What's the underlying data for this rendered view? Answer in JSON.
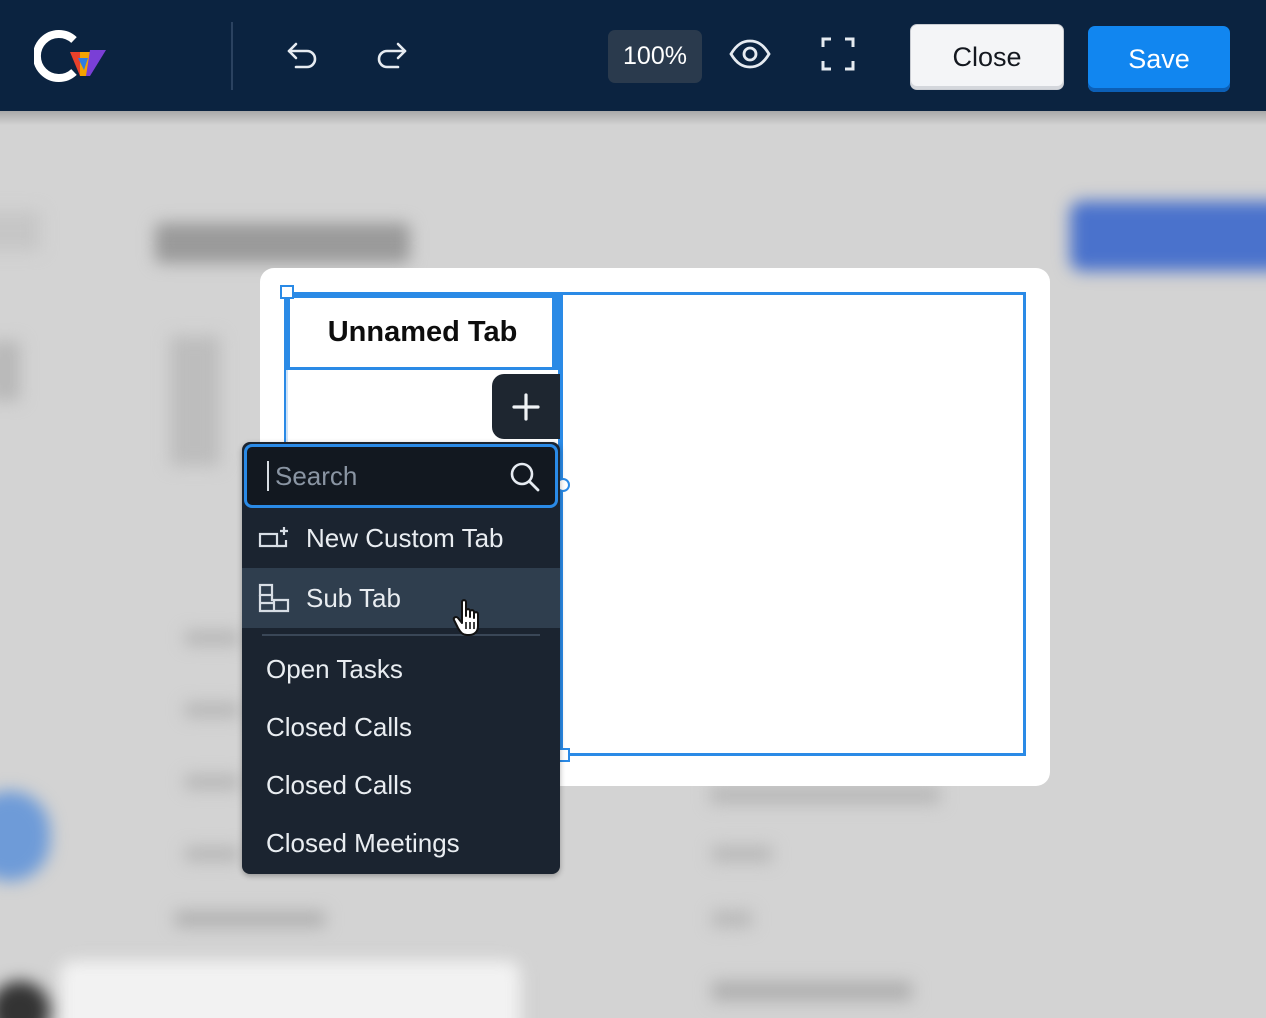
{
  "toolbar": {
    "zoom": "100%",
    "close_label": "Close",
    "save_label": "Save",
    "icons": [
      "logo-icon",
      "undo-icon",
      "redo-icon",
      "preview-eye-icon",
      "fullscreen-icon"
    ]
  },
  "canvas": {
    "tab_title": "Unnamed Tab"
  },
  "dropdown": {
    "search_placeholder": "Search",
    "actions": [
      {
        "label": "New Custom Tab",
        "icon": "new-custom-tab-icon"
      },
      {
        "label": "Sub Tab",
        "icon": "sub-tab-icon"
      }
    ],
    "items": [
      "Open Tasks",
      "Closed Calls",
      "Closed Calls",
      "Closed Meetings"
    ]
  },
  "colors": {
    "topbar": "#0b2340",
    "accent": "#2a8ae6",
    "save_button": "#1186f0",
    "dropdown_bg": "#1b2430"
  }
}
